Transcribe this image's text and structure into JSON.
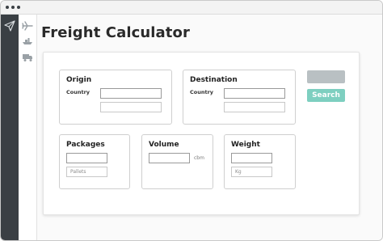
{
  "page_title": "Freight Calculator",
  "origin": {
    "title": "Origin",
    "country_label": "Country"
  },
  "destination": {
    "title": "Destination",
    "country_label": "Country"
  },
  "packages": {
    "title": "Packages",
    "secondary_placeholder": "Pallets"
  },
  "volume": {
    "title": "Volume",
    "unit": "cbm"
  },
  "weight": {
    "title": "Weight",
    "secondary_placeholder": "Kg"
  },
  "actions": {
    "search_label": "Search"
  },
  "colors": {
    "sidebar_dark": "#3a3f44",
    "accent_teal": "#7ecfc0",
    "button_grey": "#b9c0c3"
  },
  "icons": [
    "paper-plane-icon",
    "airplane-icon",
    "ship-icon",
    "truck-icon"
  ]
}
